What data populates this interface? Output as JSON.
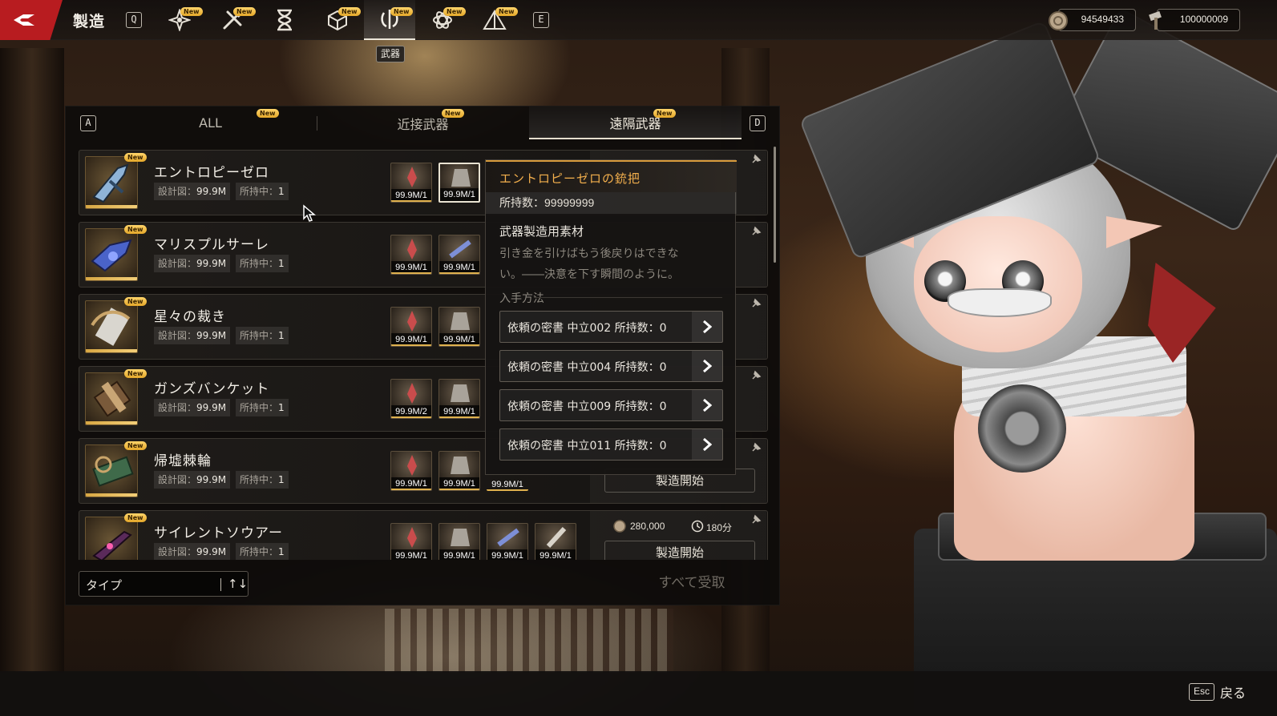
{
  "header": {
    "title": "製造",
    "prev_key": "Q",
    "next_key": "E",
    "new_badge": "New",
    "active_tooltip": "武器",
    "categories": [
      {
        "icon": "flower-blade-icon",
        "new": true
      },
      {
        "icon": "crossed-tools-icon",
        "new": true
      },
      {
        "icon": "hourglass-icon",
        "new": false
      },
      {
        "icon": "cube-icon",
        "new": true
      },
      {
        "icon": "weapon-emblem-icon",
        "new": true,
        "active": true
      },
      {
        "icon": "atom-icon",
        "new": true
      },
      {
        "icon": "pyramid-icon",
        "new": true
      }
    ],
    "currencies": [
      {
        "icon": "coin-icon",
        "value": "94549433"
      },
      {
        "icon": "hammer-icon",
        "value": "100000009"
      }
    ]
  },
  "subtabs": {
    "left_key": "A",
    "right_key": "D",
    "items": [
      {
        "label": "ALL",
        "new": true
      },
      {
        "label": "近接武器",
        "new": true
      },
      {
        "label": "遠隔武器",
        "new": true,
        "active": true
      }
    ]
  },
  "labels": {
    "blueprint": "設計図：",
    "owned": "所持中：",
    "start": "製造開始",
    "claim_all": "すべて受取",
    "type_filter": "タイプ",
    "sort_icon": "↑↓",
    "back": "戻る",
    "esc": "Esc"
  },
  "items": [
    {
      "name": "エントロピーゼロ",
      "blueprint": "99.9M",
      "owned": "1",
      "mats": [
        "99.9M/1",
        "99.9M/1"
      ],
      "selected_mat": 1
    },
    {
      "name": "マリスプルサーレ",
      "blueprint": "99.9M",
      "owned": "1",
      "mats": [
        "99.9M/1",
        "99.9M/1"
      ]
    },
    {
      "name": "星々の裁き",
      "blueprint": "99.9M",
      "owned": "1",
      "mats": [
        "99.9M/1",
        "99.9M/1"
      ]
    },
    {
      "name": "ガンズバンケット",
      "blueprint": "99.9M",
      "owned": "1",
      "mats": [
        "99.9M/2",
        "99.9M/1"
      ]
    },
    {
      "name": "帰墟棘輪",
      "blueprint": "99.9M",
      "owned": "1",
      "mats": [
        "99.9M/1",
        "99.9M/1",
        "99.9M/1"
      ]
    },
    {
      "name": "サイレントソウアー",
      "blueprint": "99.9M",
      "owned": "1",
      "mats": [
        "99.9M/1",
        "99.9M/1",
        "99.9M/1",
        "99.9M/1"
      ],
      "cost": "280,000",
      "time": "180分"
    }
  ],
  "popup": {
    "title": "エントロピーゼロの銃把",
    "count_label": "所持数：",
    "count_value": "99999999",
    "category": "武器製造用素材",
    "desc_line1": "引き金を引けばもう後戻りはできな",
    "desc_line2": "い。――決意を下す瞬間のように。",
    "obtain_label": "入手方法",
    "sources": [
      "依頼の密書 中立002 所持数：0",
      "依頼の密書 中立004 所持数：0",
      "依頼の密書 中立009 所持数：0",
      "依頼の密書 中立011 所持数：0"
    ]
  },
  "colors": {
    "accent_gold": "#f4b04d",
    "brand_red": "#b81c20",
    "new_badge": "#e3a72a"
  }
}
